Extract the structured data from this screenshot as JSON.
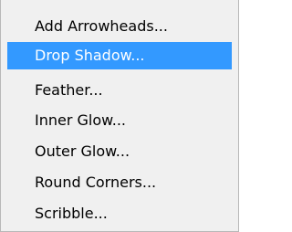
{
  "menu": {
    "items": [
      {
        "label": "Add Arrowheads..."
      },
      {
        "label": "Drop Shadow...",
        "selected": true
      },
      {
        "label": "Feather..."
      },
      {
        "label": "Inner Glow..."
      },
      {
        "label": "Outer Glow..."
      },
      {
        "label": "Round Corners..."
      },
      {
        "label": "Scribble..."
      }
    ],
    "colors": {
      "background": "#f0f0f0",
      "highlight": "#3399ff",
      "highlight_text": "#ffffff",
      "text": "#000000",
      "border": "#b8b8b8"
    }
  }
}
